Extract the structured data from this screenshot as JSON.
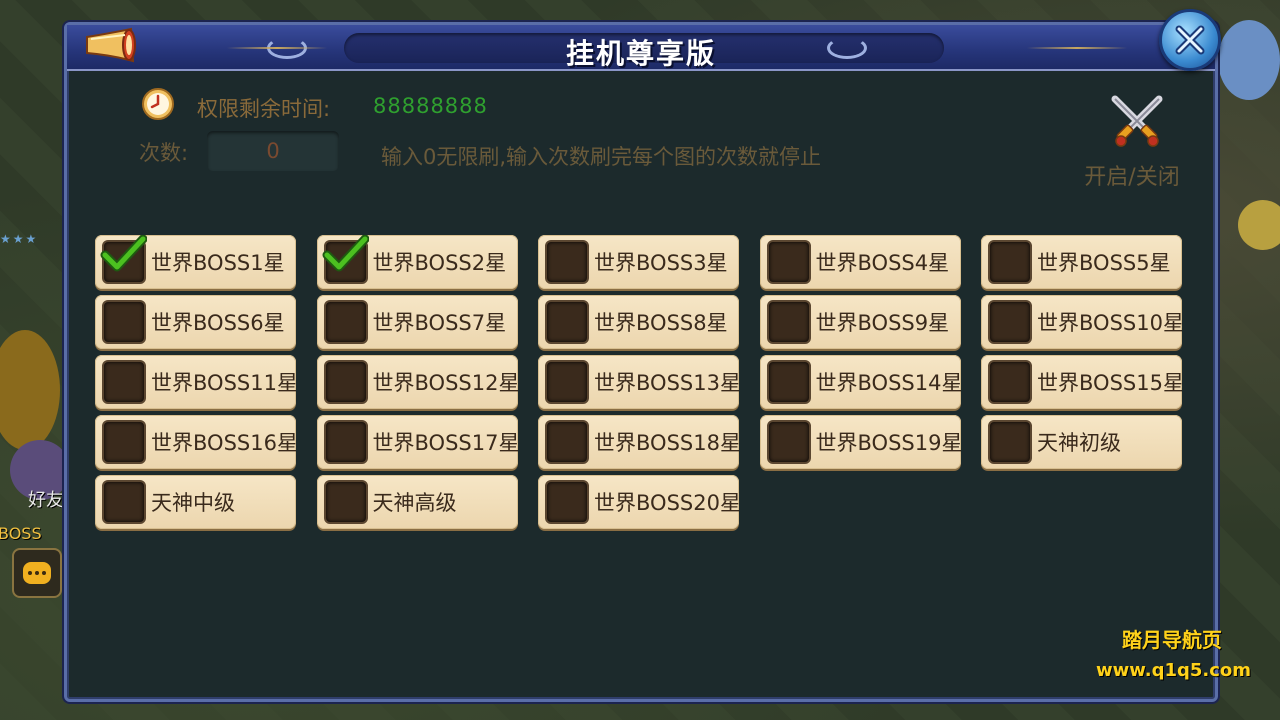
{
  "dialog": {
    "title": "挂机尊享版",
    "close_icon": "close-icon",
    "horn_icon": "horn-icon"
  },
  "time": {
    "label": "权限剩余时间:",
    "value": "88888888",
    "icon": "clock-icon"
  },
  "count": {
    "label": "次数:",
    "value": "0",
    "hint": "输入0无限刷,输入次数刷完每个图的次数就停止"
  },
  "toggle": {
    "label": "开启/关闭",
    "icon": "crossed-swords-icon"
  },
  "bosses": [
    {
      "label": "世界BOSS1星",
      "checked": true
    },
    {
      "label": "世界BOSS2星",
      "checked": true
    },
    {
      "label": "世界BOSS3星",
      "checked": false
    },
    {
      "label": "世界BOSS4星",
      "checked": false
    },
    {
      "label": "世界BOSS5星",
      "checked": false
    },
    {
      "label": "世界BOSS6星",
      "checked": false
    },
    {
      "label": "世界BOSS7星",
      "checked": false
    },
    {
      "label": "世界BOSS8星",
      "checked": false
    },
    {
      "label": "世界BOSS9星",
      "checked": false
    },
    {
      "label": "世界BOSS10星",
      "checked": false
    },
    {
      "label": "世界BOSS11星",
      "checked": false
    },
    {
      "label": "世界BOSS12星",
      "checked": false
    },
    {
      "label": "世界BOSS13星",
      "checked": false
    },
    {
      "label": "世界BOSS14星",
      "checked": false
    },
    {
      "label": "世界BOSS15星",
      "checked": false
    },
    {
      "label": "世界BOSS16星",
      "checked": false
    },
    {
      "label": "世界BOSS17星",
      "checked": false
    },
    {
      "label": "世界BOSS18星",
      "checked": false
    },
    {
      "label": "世界BOSS19星",
      "checked": false
    },
    {
      "label": "天神初级",
      "checked": false
    },
    {
      "label": "天神中级",
      "checked": false
    },
    {
      "label": "天神高级",
      "checked": false
    },
    {
      "label": "世界BOSS20星",
      "checked": false
    }
  ],
  "background": {
    "friend_text": "好友",
    "boss_text": "BOSS",
    "chat_icon": "chat-bubble-icon"
  },
  "watermark": {
    "title": "踏月导航页",
    "url": "www.q1q5.com"
  },
  "colors": {
    "title_bar": "#26357a",
    "panel_bg": "#1c2a2c",
    "time_value": "#2fa02f",
    "item_bg": "#f6e6c6",
    "check": "#4cc020",
    "watermark": "#ffd21a"
  }
}
